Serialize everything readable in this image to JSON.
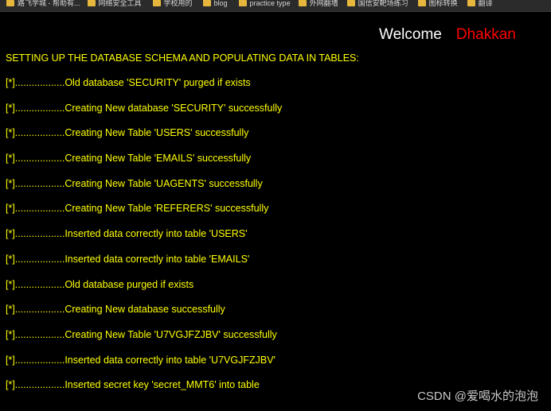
{
  "bookmarks": [
    {
      "label": "路飞学城 - 帮助有...",
      "icon": "folder-icon"
    },
    {
      "label": "网络安全工具",
      "icon": "folder-icon"
    },
    {
      "label": "学校用的",
      "icon": "folder-icon"
    },
    {
      "label": "blog",
      "icon": "folder-icon"
    },
    {
      "label": "practice type",
      "icon": "folder-icon"
    },
    {
      "label": "外网翻墙",
      "icon": "folder-icon"
    },
    {
      "label": "国信安靶场练习",
      "icon": "folder-icon"
    },
    {
      "label": "图标转换",
      "icon": "folder-icon"
    },
    {
      "label": "翻译",
      "icon": "folder-icon"
    }
  ],
  "header": {
    "welcome": "Welcome",
    "username": "Dhakkan"
  },
  "setup": {
    "heading": "SETTING UP THE DATABASE SCHEMA AND POPULATING DATA IN TABLES:",
    "lines": [
      "[*]..................Old database 'SECURITY' purged if exists",
      "[*]..................Creating New database 'SECURITY' successfully",
      "[*]..................Creating New Table 'USERS' successfully",
      "[*]..................Creating New Table 'EMAILS' successfully",
      "[*]..................Creating New Table 'UAGENTS' successfully",
      "[*]..................Creating New Table 'REFERERS' successfully",
      "[*]..................Inserted data correctly into table 'USERS'",
      "[*]..................Inserted data correctly into table 'EMAILS'",
      "[*]..................Old database purged if exists",
      "[*]..................Creating New database successfully",
      "[*]..................Creating New Table 'U7VGJFZJBV' successfully",
      "[*]..................Inserted data correctly into table 'U7VGJFZJBV'",
      "[*]..................Inserted secret key 'secret_MMT6' into table"
    ]
  },
  "watermark": "CSDN @爱喝水的泡泡",
  "colors": {
    "background": "#000000",
    "log_text": "#ffff00",
    "welcome_text": "#ffffff",
    "username_text": "#ff0000",
    "folder_icon": "#e6b73c"
  }
}
